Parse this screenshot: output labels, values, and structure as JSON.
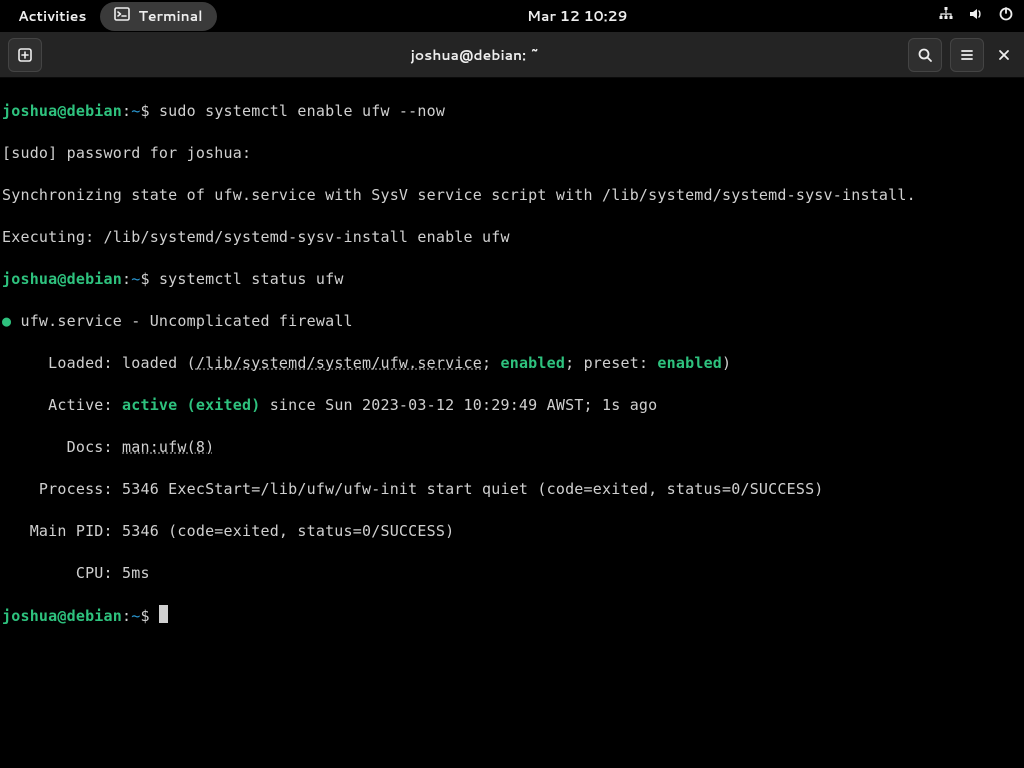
{
  "topbar": {
    "activities": "Activities",
    "app_name": "Terminal",
    "clock": "Mar 12  10:29"
  },
  "window": {
    "title": "joshua@debian: ~"
  },
  "prompt": {
    "user_host": "joshua@debian",
    "colon": ":",
    "tilde": "~",
    "dollar": "$ "
  },
  "lines": {
    "cmd1": "sudo systemctl enable ufw --now",
    "l2": "[sudo] password for joshua: ",
    "l3": "Synchronizing state of ufw.service with SysV service script with /lib/systemd/systemd-sysv-install.",
    "l4": "Executing: /lib/systemd/systemd-sysv-install enable ufw",
    "cmd2": "systemctl status ufw",
    "l6_bullet": "● ",
    "l6_rest": "ufw.service - Uncomplicated firewall",
    "l7_a": "     Loaded: loaded (",
    "l7_link": "/lib/systemd/system/ufw.service",
    "l7_b": "; ",
    "l7_enabled1": "enabled",
    "l7_c": "; preset: ",
    "l7_enabled2": "enabled",
    "l7_d": ")",
    "l8_a": "     Active: ",
    "l8_active": "active (exited)",
    "l8_b": " since Sun 2023-03-12 10:29:49 AWST; 1s ago",
    "l9_a": "       Docs: ",
    "l9_link": "man:ufw(8)",
    "l10": "    Process: 5346 ExecStart=/lib/ufw/ufw-init start quiet (code=exited, status=0/SUCCESS)",
    "l11": "   Main PID: 5346 (code=exited, status=0/SUCCESS)",
    "l12": "        CPU: 5ms"
  }
}
